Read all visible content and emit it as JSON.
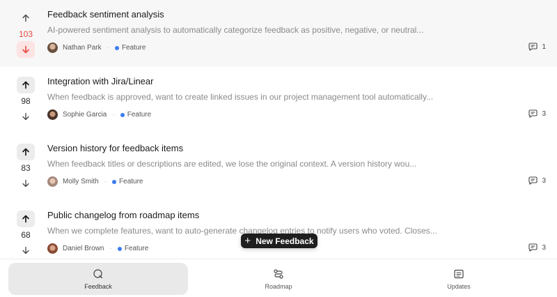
{
  "feedback_items": [
    {
      "title": "Feedback sentiment analysis",
      "description": "AI-powered sentiment analysis to automatically categorize feedback as positive, negative, or neutral...",
      "votes": "103",
      "author": "Nathan Park",
      "tag": "Feature",
      "comments": "1",
      "vote_state": "downvoted"
    },
    {
      "title": "Integration with Jira/Linear",
      "description": "When feedback is approved, want to create linked issues in our project management tool automatically...",
      "votes": "98",
      "author": "Sophie Garcia",
      "tag": "Feature",
      "comments": "3",
      "vote_state": "none"
    },
    {
      "title": "Version history for feedback items",
      "description": "When feedback titles or descriptions are edited, we lose the original context. A version history wou...",
      "votes": "83",
      "author": "Molly Smith",
      "tag": "Feature",
      "comments": "3",
      "vote_state": "none"
    },
    {
      "title": "Public changelog from roadmap items",
      "description": "When we complete features, want to auto-generate changelog entries to notify users who voted. Closes...",
      "votes": "68",
      "author": "Daniel Brown",
      "tag": "Feature",
      "comments": "3",
      "vote_state": "none"
    }
  ],
  "new_feedback_label": "New Feedback",
  "tabs": {
    "feedback": "Feedback",
    "roadmap": "Roadmap",
    "updates": "Updates"
  },
  "colors": {
    "accent_red": "#e5483f",
    "tag_blue": "#3b7bf0"
  }
}
